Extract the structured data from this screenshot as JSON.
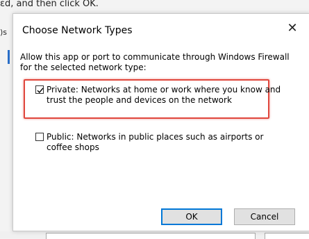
{
  "background": {
    "top_text": "ɛd, and then click OK.",
    "side_text": ")s"
  },
  "dialog": {
    "title": "Choose Network Types",
    "close_glyph": "✕",
    "description": "Allow this app or port to communicate through Windows Firewall for the selected network type:",
    "options": [
      {
        "label": "Private:  Networks at home or work where you know and trust the people and devices on the network",
        "checked": true
      },
      {
        "label": "Public:  Networks in public places such as airports or coffee shops",
        "checked": false
      }
    ],
    "ok_label": "OK",
    "cancel_label": "Cancel"
  },
  "colors": {
    "highlight": "#e0473d",
    "default_button_border": "#0078d7"
  }
}
